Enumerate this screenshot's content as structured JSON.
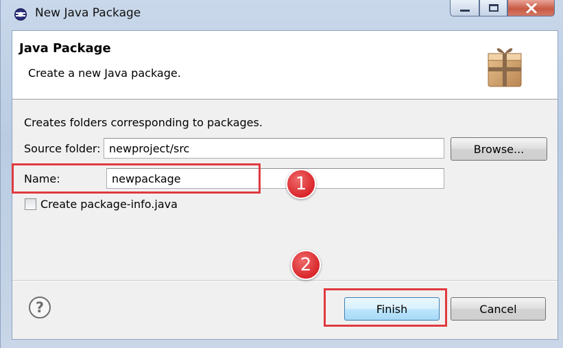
{
  "window": {
    "title": "New Java Package",
    "icon": "eclipse-icon",
    "controls": [
      "minimize-icon",
      "maximize-icon",
      "close-icon"
    ],
    "close_color": "#c85a45"
  },
  "header": {
    "title": "Java Package",
    "description": "Create a new Java package.",
    "icon": "package-icon"
  },
  "form": {
    "description": "Creates folders corresponding to packages.",
    "source_folder": {
      "label": "Source folder:",
      "value": "newproject/src"
    },
    "name": {
      "label": "Name:",
      "value": "newpackage"
    },
    "package_info_checkbox": {
      "label": "Create package-info.java",
      "checked": false
    }
  },
  "buttons": {
    "browse": "Browse...",
    "finish": "Finish",
    "cancel": "Cancel",
    "help_icon": "help-icon"
  },
  "annotations": {
    "step1": "1",
    "step2": "2",
    "color": "#e0393e"
  }
}
